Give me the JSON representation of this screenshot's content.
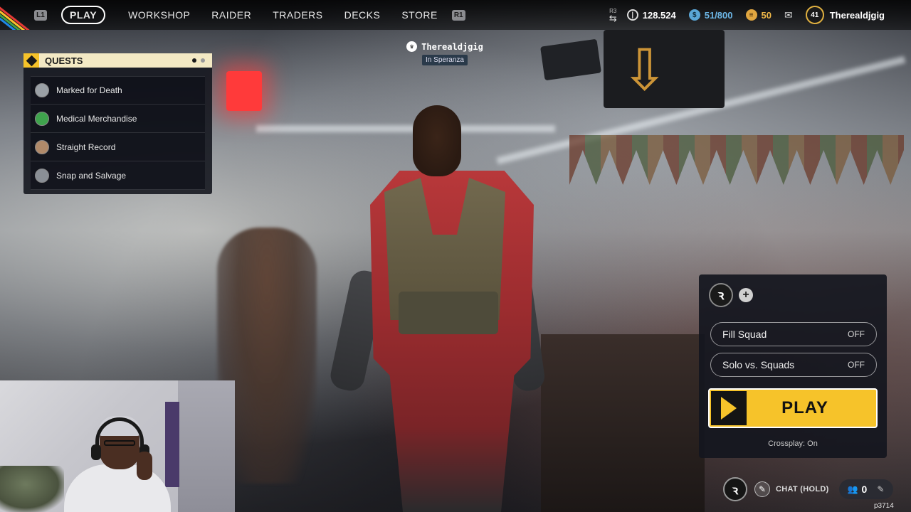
{
  "nav": {
    "left_hint": "L1",
    "right_hint": "R1",
    "items": [
      {
        "label": "PLAY",
        "active": true
      },
      {
        "label": "WORKSHOP",
        "active": false
      },
      {
        "label": "RAIDER",
        "active": false
      },
      {
        "label": "TRADERS",
        "active": false
      },
      {
        "label": "DECKS",
        "active": false
      },
      {
        "label": "STORE",
        "active": false
      }
    ]
  },
  "status": {
    "r3_hint": "R3",
    "coins": "128.524",
    "credits": "51/800",
    "tokens": "50",
    "level": "41",
    "username": "Therealdjgig",
    "colors": {
      "credits": "#6cb6e6",
      "tokens": "#f0b848",
      "level_ring": "#e0b040"
    }
  },
  "quests": {
    "title": "QUESTS",
    "items": [
      {
        "label": "Marked for Death",
        "avatar_color": "#9aa0a6"
      },
      {
        "label": "Medical Merchandise",
        "avatar_color": "#3fa34d"
      },
      {
        "label": "Straight Record",
        "avatar_color": "#b08a6a"
      },
      {
        "label": "Snap and Salvage",
        "avatar_color": "#8a8f96"
      }
    ]
  },
  "player": {
    "name": "Therealdjgig",
    "location": "In Speranza"
  },
  "play_panel": {
    "fill_squad": {
      "label": "Fill Squad",
      "value": "OFF"
    },
    "solo_vs_squads": {
      "label": "Solo vs. Squads",
      "value": "OFF"
    },
    "play_label": "PLAY",
    "crossplay": "Crossplay: On",
    "accent": "#f6c32a"
  },
  "hud": {
    "chat": "CHAT (HOLD)",
    "friends_count": "0",
    "code": "p3714"
  }
}
